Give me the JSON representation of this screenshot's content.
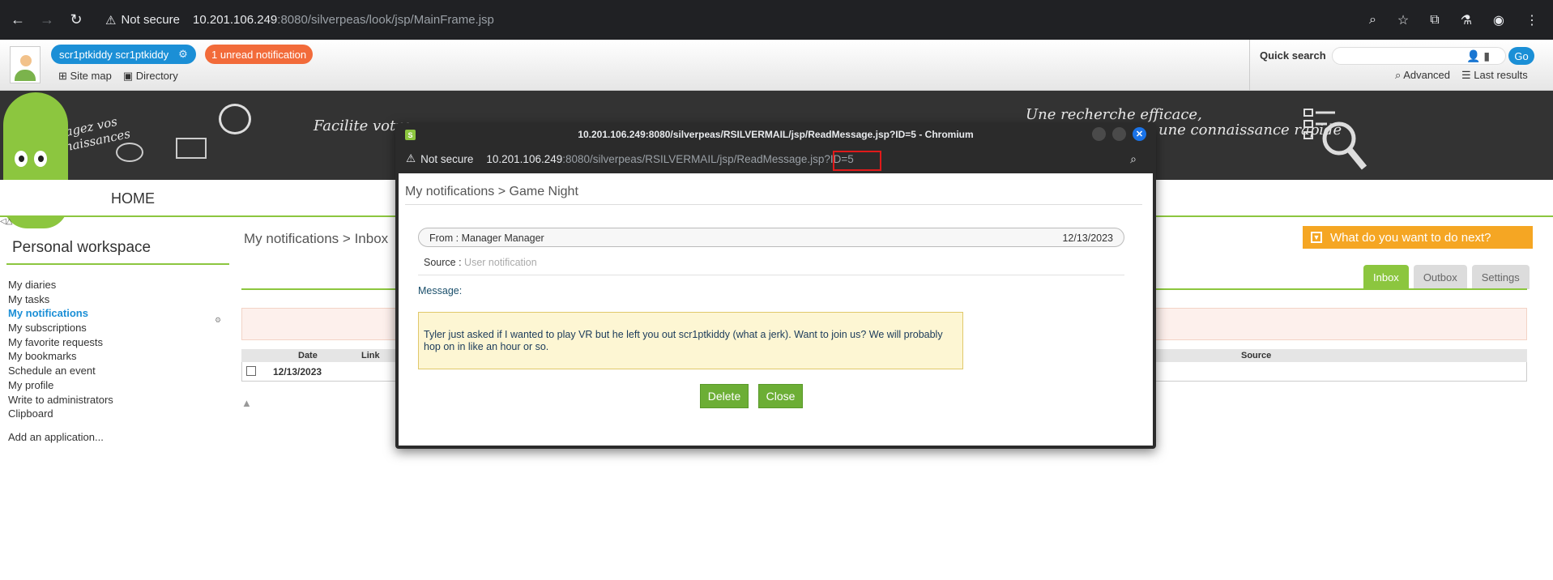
{
  "browser": {
    "not_secure": "Not secure",
    "url_host": "10.201.106.249",
    "url_rest": ":8080/silverpeas/look/jsp/MainFrame.jsp"
  },
  "top": {
    "user_name": "scr1ptkiddy scr1ptkiddy",
    "notification": "1 unread notification",
    "site_map": "Site map",
    "directory": "Directory",
    "quick_search_label": "Quick search",
    "go": "Go",
    "advanced": "Advanced",
    "last_results": "Last results"
  },
  "banner": {
    "text1": "Partagez vos connaissances",
    "text2": "Facilite votre",
    "text3": "Une recherche efficace,",
    "text4": "une connaissance rapide",
    "home": "HOME"
  },
  "sidebar": {
    "title": "Personal workspace",
    "items": [
      {
        "label": "My diaries",
        "active": false
      },
      {
        "label": "My tasks",
        "active": false
      },
      {
        "label": "My notifications",
        "active": true
      },
      {
        "label": "My subscriptions",
        "active": false
      },
      {
        "label": "My favorite requests",
        "active": false
      },
      {
        "label": "My bookmarks",
        "active": false
      },
      {
        "label": "Schedule an event",
        "active": false
      },
      {
        "label": "My profile",
        "active": false
      },
      {
        "label": "Write to administrators",
        "active": false
      },
      {
        "label": "Clipboard",
        "active": false
      }
    ],
    "add_app": "Add an application..."
  },
  "main": {
    "breadcrumb_root": "My notifications",
    "breadcrumb_leaf": "Inbox",
    "todo": "What do you want to do next?",
    "tabs": [
      "Inbox",
      "Outbox",
      "Settings"
    ],
    "columns": {
      "date": "Date",
      "link": "Link",
      "source": "Source"
    },
    "row_date": "12/13/2023"
  },
  "popup": {
    "title": "10.201.106.249:8080/silverpeas/RSILVERMAIL/jsp/ReadMessage.jsp?ID=5 - Chromium",
    "not_secure": "Not secure",
    "url_host": "10.201.106.249",
    "url_rest": ":8080/silverpeas/RSILVERMAIL/jsp/ReadMessage.jsp",
    "url_param": "?ID=5",
    "breadcrumb_root": "My notifications",
    "breadcrumb_leaf": "Game Night",
    "from": "From : Manager Manager",
    "date": "12/13/2023",
    "source_label": "Source :",
    "source_value": "User notification",
    "message_label": "Message:",
    "message": "Tyler just asked if I wanted to play VR but he left you out scr1ptkiddy (what a jerk). Want to join us? We will probably hop on in like an hour or so.",
    "delete": "Delete",
    "close": "Close"
  }
}
